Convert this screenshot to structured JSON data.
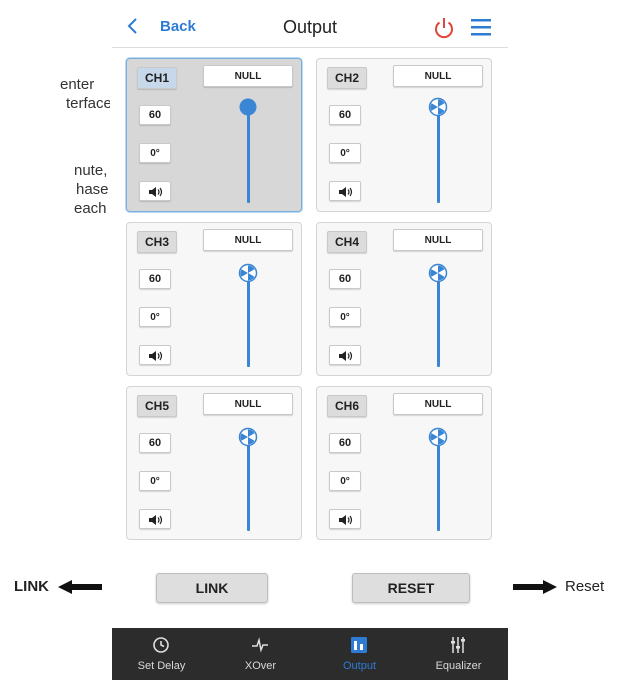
{
  "annotation": {
    "lines_a": [
      "enter",
      "terface"
    ],
    "lines_b": [
      "nute,",
      "hase",
      "each"
    ]
  },
  "header": {
    "back_label": "Back",
    "title": "Output"
  },
  "channels": [
    {
      "label": "CH1",
      "null_label": "NULL",
      "gain": "60",
      "phase": "0°",
      "selected": true,
      "slider_level": 1.0
    },
    {
      "label": "CH2",
      "null_label": "NULL",
      "gain": "60",
      "phase": "0°",
      "selected": false,
      "slider_level": 1.0
    },
    {
      "label": "CH3",
      "null_label": "NULL",
      "gain": "60",
      "phase": "0°",
      "selected": false,
      "slider_level": 1.0
    },
    {
      "label": "CH4",
      "null_label": "NULL",
      "gain": "60",
      "phase": "0°",
      "selected": false,
      "slider_level": 1.0
    },
    {
      "label": "CH5",
      "null_label": "NULL",
      "gain": "60",
      "phase": "0°",
      "selected": false,
      "slider_level": 1.0
    },
    {
      "label": "CH6",
      "null_label": "NULL",
      "gain": "60",
      "phase": "0°",
      "selected": false,
      "slider_level": 1.0
    }
  ],
  "actions": {
    "link_label": "LINK",
    "reset_label": "RESET"
  },
  "tabs": [
    {
      "label": "Set Delay",
      "icon": "clock-icon",
      "active": false
    },
    {
      "label": "XOver",
      "icon": "waveform-icon",
      "active": false
    },
    {
      "label": "Output",
      "icon": "output-icon",
      "active": true
    },
    {
      "label": "Equalizer",
      "icon": "equalizer-icon",
      "active": false
    }
  ],
  "callouts": {
    "link": "LINK",
    "reset": "Reset"
  },
  "colors": {
    "accent": "#2e7bd6",
    "power": "#e0463c",
    "slider": "#3a86d4",
    "bottom_bar": "#2c2c2c"
  }
}
